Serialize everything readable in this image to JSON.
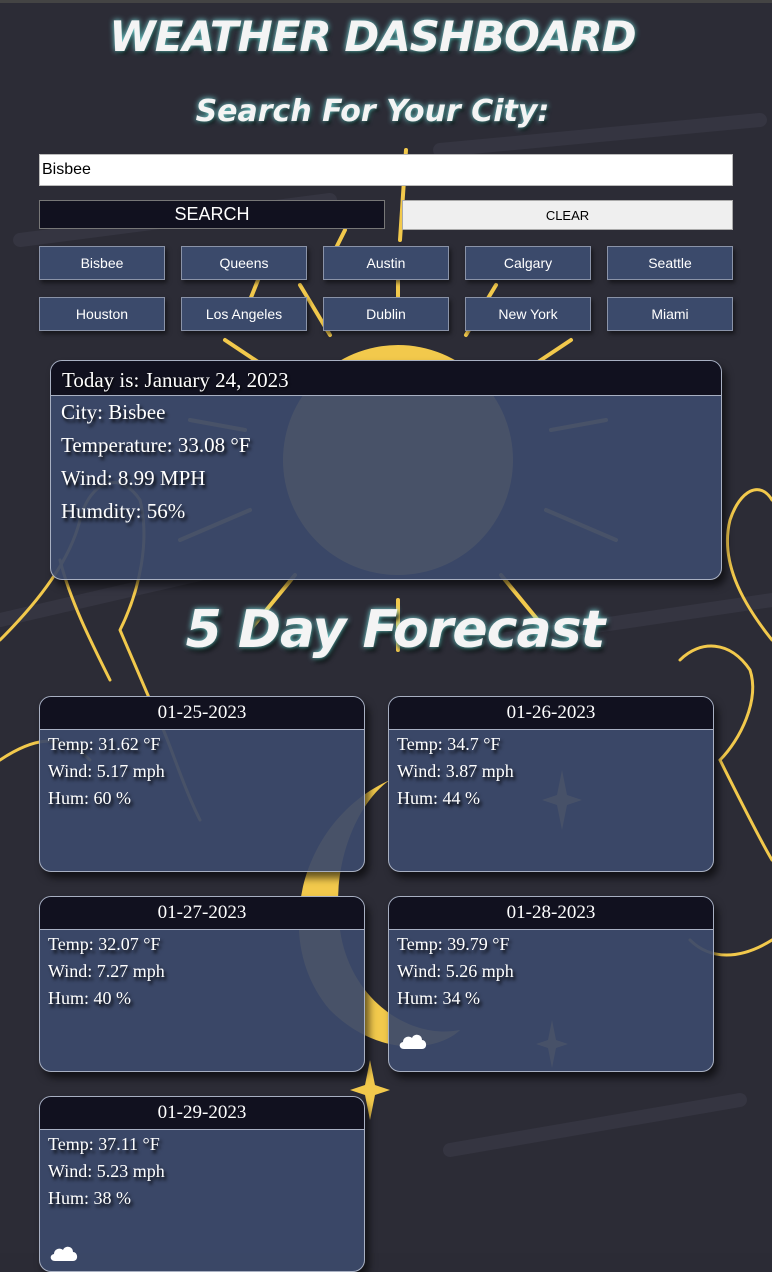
{
  "header": {
    "title": "WEATHER DASHBOARD",
    "search_heading": "Search For Your City:"
  },
  "search": {
    "value": "Bisbee",
    "search_label": "SEARCH",
    "clear_label": "CLEAR"
  },
  "history": [
    "Bisbee",
    "Queens",
    "Austin",
    "Calgary",
    "Seattle",
    "Houston",
    "Los Angeles",
    "Dublin",
    "New York",
    "Miami"
  ],
  "today": {
    "date_line": "Today is: January 24, 2023",
    "city": "City: Bisbee",
    "temperature": "Temperature: 33.08 °F",
    "wind": "Wind: 8.99 MPH",
    "humidity": "Humdity: 56%"
  },
  "forecast_heading": "5 Day Forecast",
  "forecast": [
    {
      "date": "01-25-2023",
      "temp": "Temp: 31.62 °F",
      "wind": "Wind: 5.17 mph",
      "hum": "Hum: 60 %",
      "icon": "none"
    },
    {
      "date": "01-26-2023",
      "temp": "Temp: 34.7 °F",
      "wind": "Wind: 3.87 mph",
      "hum": "Hum: 44 %",
      "icon": "none"
    },
    {
      "date": "01-27-2023",
      "temp": "Temp: 32.07 °F",
      "wind": "Wind: 7.27 mph",
      "hum": "Hum: 40 %",
      "icon": "none"
    },
    {
      "date": "01-28-2023",
      "temp": "Temp: 39.79 °F",
      "wind": "Wind: 5.26 mph",
      "hum": "Hum: 34 %",
      "icon": "cloud-icon"
    },
    {
      "date": "01-29-2023",
      "temp": "Temp: 37.11 °F",
      "wind": "Wind: 5.23 mph",
      "hum": "Hum: 38 %",
      "icon": "cloud-icon"
    }
  ],
  "colors": {
    "background": "#2b2b35",
    "card": "#3b4a6b",
    "card_header": "#11111f",
    "accent_gold": "#f2c94c",
    "title_glow": "#7fe7e7"
  }
}
